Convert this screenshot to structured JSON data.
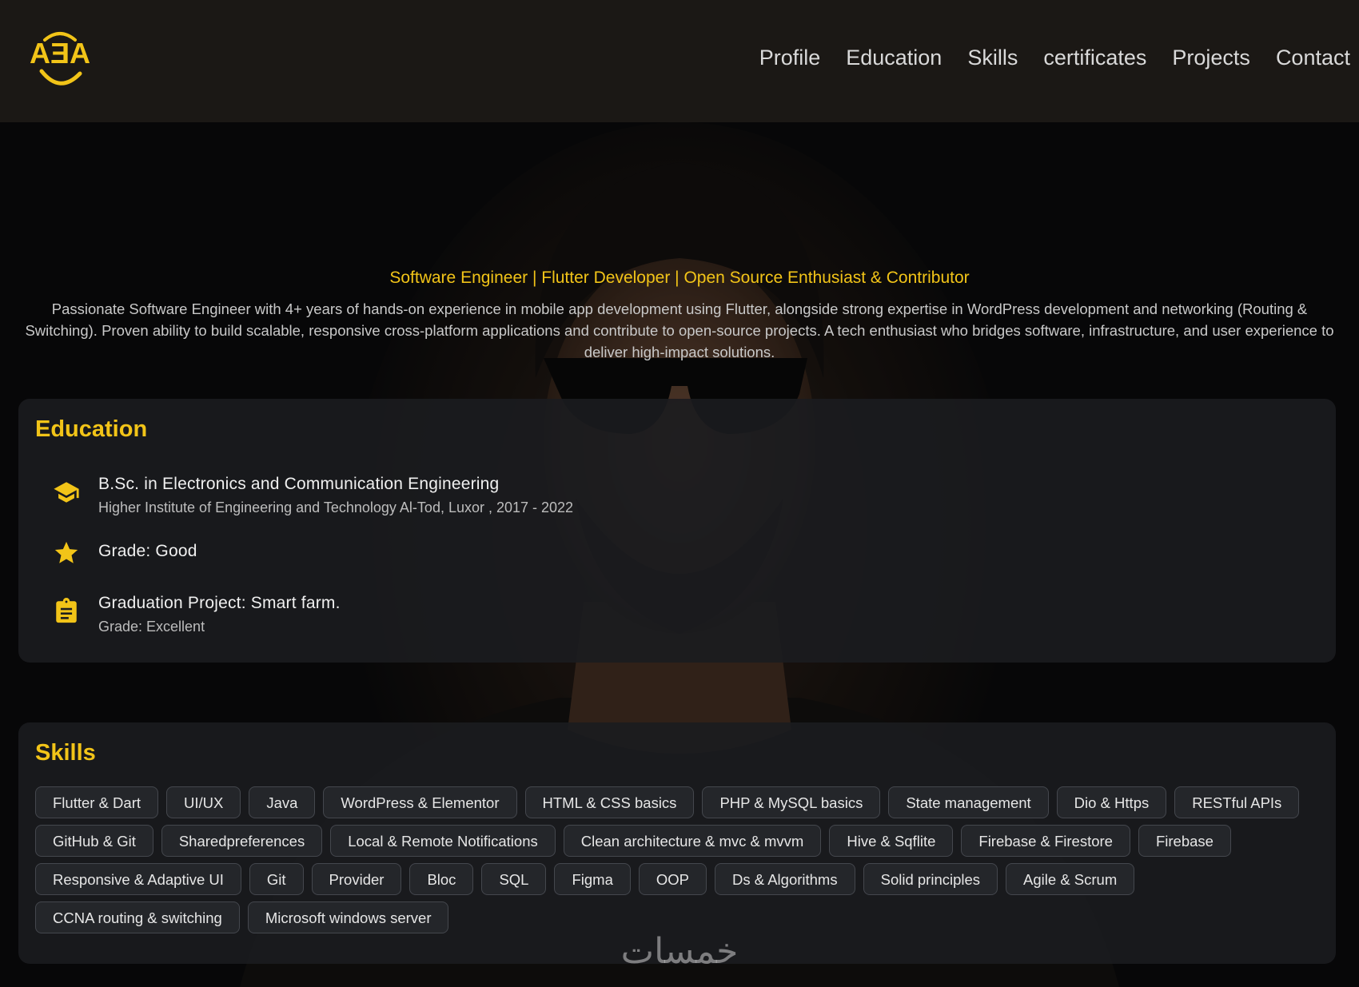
{
  "header": {
    "logo_text": "AƎA",
    "nav": [
      "Profile",
      "Education",
      "Skills",
      "certificates",
      "Projects",
      "Contact"
    ]
  },
  "hero": {
    "tagline": "Software Engineer | Flutter Developer | Open Source Enthusiast & Contributor",
    "summary": "Passionate Software Engineer with 4+ years of hands-on experience in mobile app development using Flutter, alongside strong expertise in WordPress development and networking (Routing & Switching). Proven ability to build scalable, responsive cross-platform applications and contribute to open-source projects. A tech enthusiast who bridges software, infrastructure, and user experience to deliver high-impact solutions."
  },
  "education": {
    "title": "Education",
    "degree": "B.Sc. in Electronics and Communication Engineering",
    "institute": "Higher Institute of Engineering and Technology Al-Tod, Luxor , 2017 - 2022",
    "grade": "Grade: Good",
    "project": "Graduation Project: Smart farm.",
    "project_grade": "Grade: Excellent"
  },
  "skills": {
    "title": "Skills",
    "items": [
      "Flutter & Dart",
      "UI/UX",
      "Java",
      "WordPress & Elementor",
      "HTML & CSS basics",
      "PHP & MySQL basics",
      "State management",
      "Dio & Https",
      "RESTful APIs",
      "GitHub & Git",
      "Sharedpreferences",
      "Local & Remote Notifications",
      "Clean architecture & mvc & mvvm",
      "Hive & Sqflite",
      "Firebase & Firestore",
      "Firebase",
      "Responsive & Adaptive UI",
      "Git",
      "Provider",
      "Bloc",
      "SQL",
      "Figma",
      "OOP",
      "Ds & Algorithms",
      "Solid principles",
      "Agile & Scrum",
      "CCNA routing & switching",
      "Microsoft windows server"
    ]
  },
  "watermark": "خمسات",
  "colors": {
    "accent": "#f2c418",
    "background": "#0c0c0d",
    "card": "#1b1c1f",
    "header": "#1b1815"
  }
}
